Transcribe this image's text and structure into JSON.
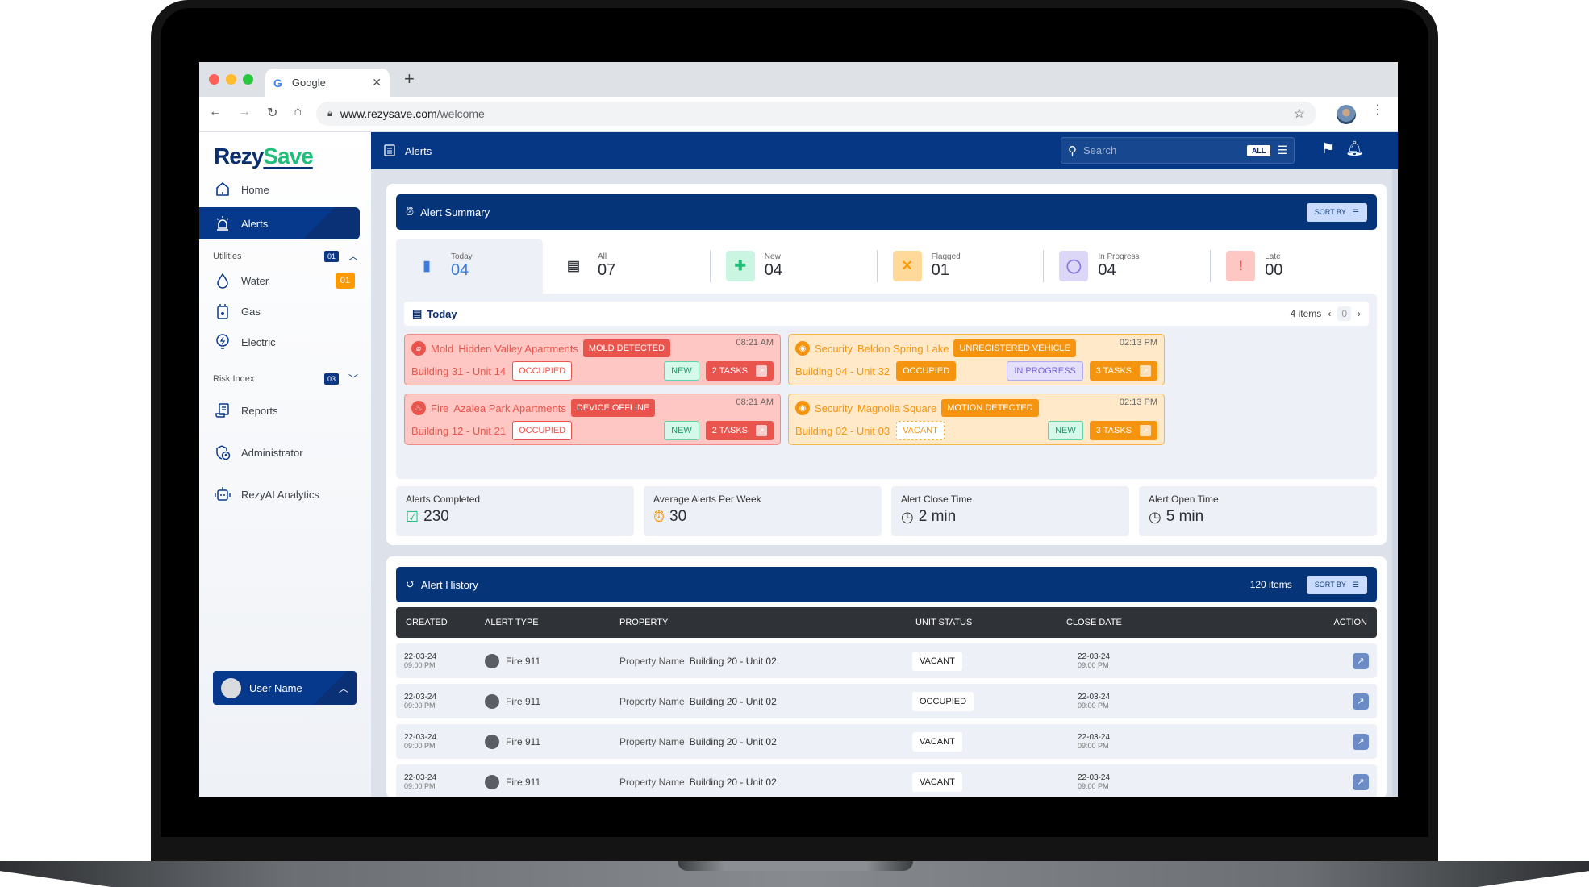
{
  "browser": {
    "tab_title": "Google",
    "url_host": "www.rezysave.com",
    "url_path": "/welcome"
  },
  "brand": {
    "part1": "Rezy",
    "part2": "Save"
  },
  "sidebar": {
    "items": [
      {
        "label": "Home",
        "icon": "home-icon"
      },
      {
        "label": "Alerts",
        "icon": "alarm-icon",
        "active": true
      }
    ],
    "utilities": {
      "label": "Utilities",
      "count": "01",
      "items": [
        {
          "label": "Water",
          "icon": "water-drop-icon",
          "badge": "01"
        },
        {
          "label": "Gas",
          "icon": "gas-meter-icon"
        },
        {
          "label": "Electric",
          "icon": "bulb-icon"
        }
      ]
    },
    "risk_index": {
      "label": "Risk Index",
      "count": "03"
    },
    "bottom_items": [
      {
        "label": "Reports",
        "icon": "report-icon"
      },
      {
        "label": "Administrator",
        "icon": "admin-shield-icon"
      },
      {
        "label": "RezyAI Analytics",
        "icon": "robot-icon"
      }
    ],
    "user": {
      "name": "User Name"
    }
  },
  "topbar": {
    "title": "Alerts",
    "search_placeholder": "Search",
    "search_scope": "ALL"
  },
  "alert_summary": {
    "title": "Alert Summary",
    "sort_label": "SORT BY",
    "stats": [
      {
        "label": "Today",
        "value": "04",
        "color": "#3b7ddd"
      },
      {
        "label": "All",
        "value": "07",
        "color": "#2f3237"
      },
      {
        "label": "New",
        "value": "04",
        "color": "#1fbf7a"
      },
      {
        "label": "Flagged",
        "value": "01",
        "color": "#ff9900"
      },
      {
        "label": "In Progress",
        "value": "04",
        "color": "#8b78e0"
      },
      {
        "label": "Late",
        "value": "00",
        "color": "#e9544c"
      }
    ],
    "today": {
      "title": "Today",
      "items_label": "4 items",
      "page": "0",
      "alerts": [
        {
          "type": "Mold",
          "property": "Hidden Valley Apartments",
          "tag": "MOLD DETECTED",
          "unit": "Building 31 - Unit 14",
          "unit_status": "OCCUPIED",
          "time": "08:21 AM",
          "status": "NEW",
          "tasks": "2 TASKS",
          "severity": "red"
        },
        {
          "type": "Security",
          "property": "Beldon Spring Lake",
          "tag": "UNREGISTERED VEHICLE",
          "unit": "Building 04 - Unit 32",
          "unit_status": "OCCUPIED",
          "time": "02:13 PM",
          "status": "IN PROGRESS",
          "tasks": "3 TASKS",
          "severity": "orange"
        },
        {
          "type": "Fire",
          "property": "Azalea Park Apartments",
          "tag": "DEVICE OFFLINE",
          "unit": "Building 12 - Unit 21",
          "unit_status": "OCCUPIED",
          "time": "08:21 AM",
          "status": "NEW",
          "tasks": "2 TASKS",
          "severity": "red"
        },
        {
          "type": "Security",
          "property": "Magnolia Square",
          "tag": "MOTION DETECTED",
          "unit": "Building 02 - Unit 03",
          "unit_status": "VACANT",
          "time": "02:13 PM",
          "status": "NEW",
          "tasks": "3 TASKS",
          "severity": "orange"
        }
      ]
    },
    "metrics": [
      {
        "label": "Alerts Completed",
        "value": "230",
        "icon": "clipboard-check-icon"
      },
      {
        "label": "Average Alerts Per Week",
        "value": "30",
        "icon": "alarm-icon"
      },
      {
        "label": "Alert Close Time",
        "value": "2 min",
        "icon": "clock-icon"
      },
      {
        "label": "Alert Open Time",
        "value": "5 min",
        "icon": "clock-icon"
      }
    ]
  },
  "alert_history": {
    "title": "Alert History",
    "items_label": "120 items",
    "sort_label": "SORT BY",
    "columns": [
      "CREATED",
      "ALERT TYPE",
      "PROPERTY",
      "UNIT STATUS",
      "CLOSE DATE",
      "ACTION"
    ],
    "rows": [
      {
        "created_date": "22-03-24",
        "created_time": "09:00 PM",
        "alert_type": "Fire 911",
        "property_name": "Property Name",
        "unit": "Building 20 - Unit 02",
        "unit_status": "VACANT",
        "close_date": "22-03-24",
        "close_time": "09:00 PM"
      },
      {
        "created_date": "22-03-24",
        "created_time": "09:00 PM",
        "alert_type": "Fire 911",
        "property_name": "Property Name",
        "unit": "Building 20 - Unit 02",
        "unit_status": "OCCUPIED",
        "close_date": "22-03-24",
        "close_time": "09:00 PM"
      },
      {
        "created_date": "22-03-24",
        "created_time": "09:00 PM",
        "alert_type": "Fire 911",
        "property_name": "Property Name",
        "unit": "Building 20 - Unit 02",
        "unit_status": "VACANT",
        "close_date": "22-03-24",
        "close_time": "09:00 PM"
      },
      {
        "created_date": "22-03-24",
        "created_time": "09:00 PM",
        "alert_type": "Fire 911",
        "property_name": "Property Name",
        "unit": "Building 20 - Unit 02",
        "unit_status": "VACANT",
        "close_date": "22-03-24",
        "close_time": "09:00 PM"
      }
    ]
  }
}
